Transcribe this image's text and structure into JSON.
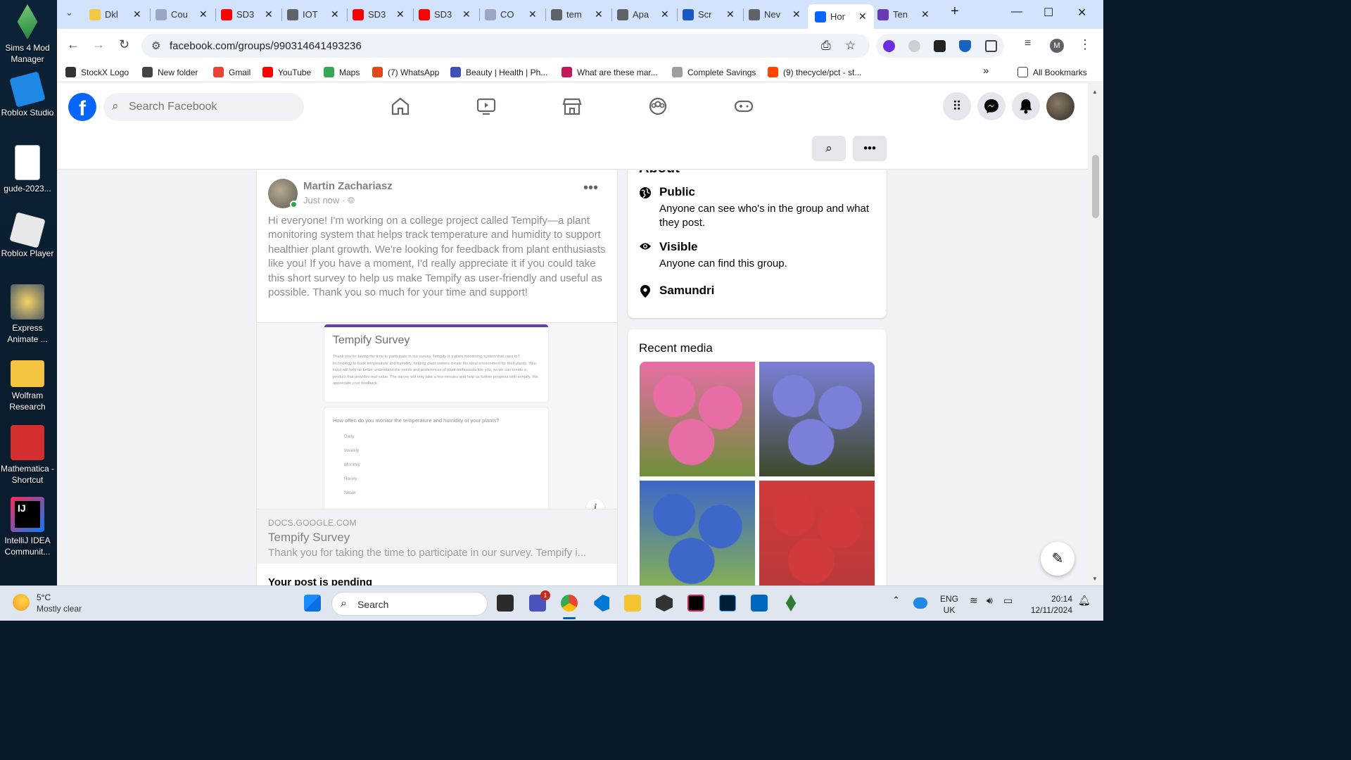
{
  "desktop": {
    "icons": [
      {
        "label": "Sims 4 Mod Manager",
        "color": "#3aa55a"
      },
      {
        "label": "Roblox Studio",
        "color": "#1e88e5"
      },
      {
        "label": "gude-2023...",
        "color": "#f1f1f1"
      },
      {
        "label": "Roblox Player",
        "color": "#e8e8e8"
      },
      {
        "label": "Express Animate ...",
        "color": "#4d5b6a"
      },
      {
        "label": "Wolfram Research",
        "color": "#f5c542"
      },
      {
        "label": "Mathematica - Shortcut",
        "color": "#d32f2f"
      },
      {
        "label": "IntelliJ IDEA Communit...",
        "color": "#1c1c3c"
      }
    ]
  },
  "browser": {
    "tabs": [
      {
        "title": "Dkl",
        "color": "#f4c842"
      },
      {
        "title": "Cou",
        "color": "#9aa6c4"
      },
      {
        "title": "SD3",
        "color": "#ff0000"
      },
      {
        "title": "IOT",
        "color": "#5f6368"
      },
      {
        "title": "SD3",
        "color": "#ff0000"
      },
      {
        "title": "SD3",
        "color": "#ff0000"
      },
      {
        "title": "CO",
        "color": "#9aa6c4"
      },
      {
        "title": "tem",
        "color": "#5f6368"
      },
      {
        "title": "Apa",
        "color": "#5f6368"
      },
      {
        "title": "Scr",
        "color": "#1a56c4"
      },
      {
        "title": "Nev",
        "color": "#5f6368"
      },
      {
        "title": "Hor",
        "color": "#0866ff"
      },
      {
        "title": "Ten",
        "color": "#673ab7"
      }
    ],
    "active_tab_index": 11,
    "url": "facebook.com/groups/990314641493236",
    "profile_initial": "M",
    "bookmarks": [
      {
        "label": "StockX Logo",
        "color": "#333333"
      },
      {
        "label": "New folder",
        "color": "#444444"
      },
      {
        "label": "Gmail",
        "color": "#ea4335"
      },
      {
        "label": "YouTube",
        "color": "#ff0000"
      },
      {
        "label": "Maps",
        "color": "#34a853"
      },
      {
        "label": "(7) WhatsApp",
        "color": "#e2471a"
      },
      {
        "label": "Beauty | Health | Ph...",
        "color": "#3f51b5"
      },
      {
        "label": "What are these mar...",
        "color": "#c2185b"
      },
      {
        "label": "Complete Savings",
        "color": "#9e9e9e"
      },
      {
        "label": "(9) thecycle/pct - st...",
        "color": "#ff4500"
      }
    ],
    "more_bookmarks": "»",
    "all_bookmarks": "All Bookmarks"
  },
  "facebook": {
    "logo": "f",
    "search_placeholder": "Search Facebook",
    "post": {
      "author": "Martin Zachariasz",
      "time": "Just now · ",
      "more": "•••",
      "text": "Hi everyone! I'm working on a college project called Tempify—a plant monitoring system that helps track temperature and humidity to support healthier plant growth. We're looking for feedback from plant enthusiasts like you! If you have a moment, I'd really appreciate it if you could take this short survey to help us make Tempify as user-friendly and useful as possible. Thank you so much for your time and support!",
      "preview": {
        "form_title": "Tempify Survey",
        "form_description": "Thank you for taking the time to participate in our survey. Tempify is a plant monitoring system that uses IoT technology to track temperature and humidity, helping plant owners create the ideal environment for their plants. Your input will help us better understand the needs and preferences of plant enthusiasts like you, so we can create a product that provides real value. The survey will only take a few minutes and help us further progress with tempify. We appreciate your feedback.",
        "question": "How often do you monitor the temperature and humidity of your plants?",
        "options": [
          "Daily",
          "Weekly",
          "Monthly",
          "Rarely",
          "Never"
        ]
      },
      "link_domain": "DOCS.GOOGLE.COM",
      "link_title": "Tempify Survey",
      "link_description": "Thank you for taking the time to participate in our survey. Tempify i...",
      "pending": "Your post is pending"
    },
    "about": {
      "heading": "About",
      "items": [
        {
          "icon": "globe-icon",
          "title": "Public",
          "desc": "Anyone can see who's in the group and what they post."
        },
        {
          "icon": "eye-icon",
          "title": "Visible",
          "desc": "Anyone can find this group."
        },
        {
          "icon": "location-pin-icon",
          "title": "Samundri",
          "desc": ""
        }
      ]
    },
    "recent_media": {
      "heading": "Recent media",
      "images": [
        {
          "alt": "pink hydrangeas",
          "c1": "#e76da4",
          "c2": "#6e8f3a"
        },
        {
          "alt": "blue purple hydrangeas",
          "c1": "#7b7fd8",
          "c2": "#3d4a2a"
        },
        {
          "alt": "blue hydrangeas by house",
          "c1": "#3d67c9",
          "c2": "#8ab54d"
        },
        {
          "alt": "red hydrangeas by door",
          "c1": "#d13a3a",
          "c2": "#b93a3a"
        }
      ]
    }
  },
  "taskbar": {
    "temperature": "5°C",
    "weather": "Mostly clear",
    "search": "Search",
    "lang1": "ENG",
    "lang2": "UK",
    "time": "20:14",
    "date": "12/11/2024",
    "teams_badge": "1"
  }
}
